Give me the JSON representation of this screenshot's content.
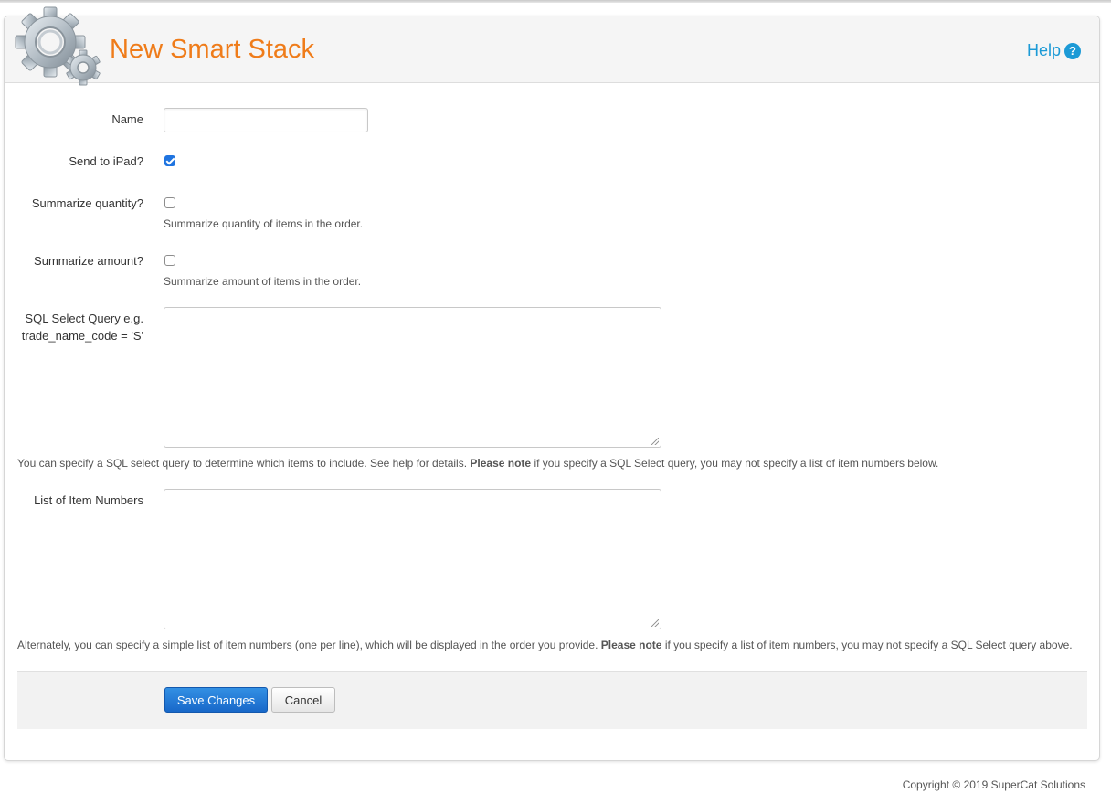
{
  "page": {
    "title": "New Smart Stack",
    "help_label": "Help",
    "help_glyph": "?"
  },
  "form": {
    "name": {
      "label": "Name",
      "value": "",
      "placeholder": ""
    },
    "send_to_ipad": {
      "label": "Send to iPad?",
      "checked": true
    },
    "summarize_quantity": {
      "label": "Summarize quantity?",
      "checked": false,
      "hint": "Summarize quantity of items in the order."
    },
    "summarize_amount": {
      "label": "Summarize amount?",
      "checked": false,
      "hint": "Summarize amount of items in the order."
    },
    "sql_query": {
      "label_line1": "SQL Select Query e.g.",
      "label_line2": "trade_name_code = 'S'",
      "value": "",
      "note_before": "You can specify a SQL select query to determine which items to include. See help for details.",
      "note_bold": "Please note",
      "note_after": "if you specify a SQL Select query, you may not specify a list of item numbers below."
    },
    "item_numbers": {
      "label": "List of Item Numbers",
      "value": "",
      "note_before": "Alternately, you can specify a simple list of item numbers (one per line), which will be displayed in the order you provide.",
      "note_bold": "Please note",
      "note_after": "if you specify a list of item numbers, you may not specify a SQL Select query above."
    }
  },
  "actions": {
    "save_label": "Save Changes",
    "cancel_label": "Cancel"
  },
  "footer": {
    "copyright": "Copyright © 2019 SuperCat Solutions"
  },
  "icons": {
    "logo": "gears-icon",
    "help": "question-circle-icon"
  },
  "colors": {
    "title": "#ef7c1a",
    "help": "#1c9ad6",
    "primary_button": "#1f74e0"
  }
}
